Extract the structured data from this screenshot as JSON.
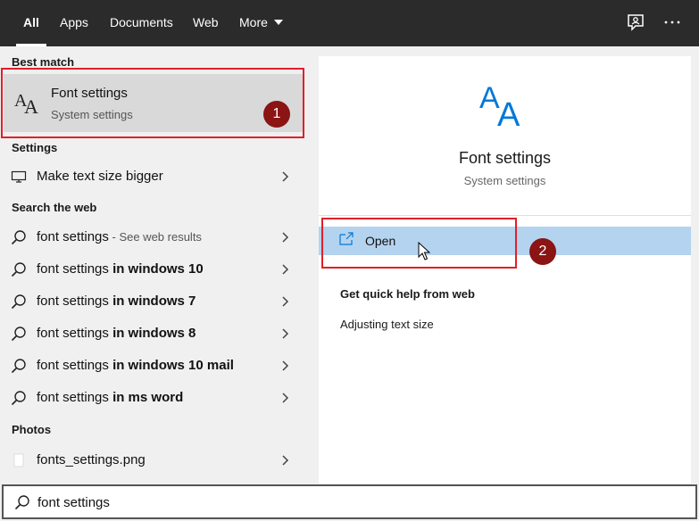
{
  "tabs": [
    {
      "label": "All",
      "active": true
    },
    {
      "label": "Apps"
    },
    {
      "label": "Documents"
    },
    {
      "label": "Web"
    },
    {
      "label": "More"
    }
  ],
  "topbar_icons": [
    "feedback-icon",
    "more-options-icon"
  ],
  "best_match": {
    "heading": "Best match",
    "title": "Font settings",
    "subtitle": "System settings",
    "icon": "font-aa-icon"
  },
  "settings": {
    "heading": "Settings",
    "items": [
      {
        "label": "Make text size bigger",
        "icon": "display-icon"
      }
    ]
  },
  "web": {
    "heading": "Search the web",
    "items": [
      {
        "plain": "font settings",
        "bold": "",
        "hint": " - See web results"
      },
      {
        "plain": "font settings ",
        "bold": "in windows 10",
        "hint": ""
      },
      {
        "plain": "font settings ",
        "bold": "in windows 7",
        "hint": ""
      },
      {
        "plain": "font settings ",
        "bold": "in windows 8",
        "hint": ""
      },
      {
        "plain": "font settings ",
        "bold": "in windows 10 mail",
        "hint": ""
      },
      {
        "plain": "font settings ",
        "bold": "in ms word",
        "hint": ""
      }
    ]
  },
  "photos": {
    "heading": "Photos",
    "items": [
      {
        "label": "fonts_settings.png",
        "icon": "image-file-icon"
      }
    ]
  },
  "preview": {
    "title": "Font settings",
    "subtitle": "System settings",
    "open_label": "Open",
    "help_heading": "Get quick help from web",
    "help_links": [
      "Adjusting text size"
    ]
  },
  "search": {
    "value": "font settings"
  },
  "annotations": [
    "1",
    "2"
  ],
  "colors": {
    "topbar": "#2b2b2b",
    "accent": "#0078d7",
    "highlight": "#b4d3ef",
    "annotation_red": "#e0202a",
    "annotation_badge": "#8b1414"
  }
}
